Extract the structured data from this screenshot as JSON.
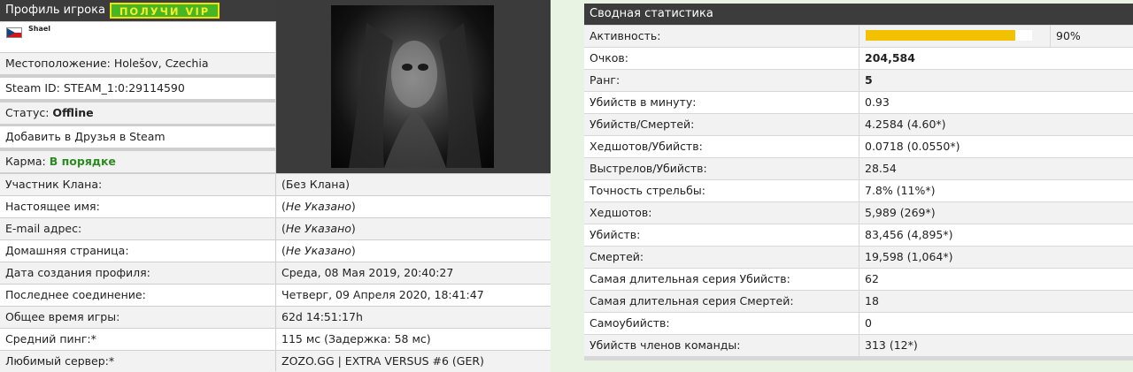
{
  "profile": {
    "header": "Профиль игрока",
    "vip_button": "ПОЛУЧИ VIP",
    "flag_icon": "czech-flag-icon",
    "nickname": "Shael",
    "location": "Местоположение: Holešov, Czechia",
    "steam_id": "Steam ID: STEAM_1:0:29114590",
    "status_label": "Статус:",
    "status_value": "Offline",
    "add_friend": "Добавить в Друзья в Steam",
    "karma_label": "Карма:",
    "karma_value": "В порядке",
    "karma_color": "#2d8b22",
    "rows": [
      {
        "label": "Участник Клана:",
        "value": "(Без Клана)",
        "italic": false
      },
      {
        "label": "Настоящее имя:",
        "value_pre": "(",
        "value_it": "Не Указано",
        "value_post": ")"
      },
      {
        "label": "E-mail адрес:",
        "value_pre": "(",
        "value_it": "Не Указано",
        "value_post": ")"
      },
      {
        "label": "Домашняя страница:",
        "value_pre": "(",
        "value_it": "Не Указано",
        "value_post": ")"
      },
      {
        "label": "Дата создания профиля:",
        "value": "Среда, 08 Мая 2019, 20:40:27"
      },
      {
        "label": "Последнее соединение:",
        "value": "Четверг, 09 Апреля 2020, 18:41:47"
      },
      {
        "label": "Общее время игры:",
        "value": "62d 14:51:17h"
      },
      {
        "label": "Средний пинг:*",
        "value": "115 мс (Задержка: 58 мс)"
      },
      {
        "label": "Любимый сервер:*",
        "value": "ZOZO.GG | EXTRA VERSUS #6 (GER)"
      }
    ]
  },
  "stats": {
    "header": "Сводная статистика",
    "activity_label": "Активность:",
    "activity_percent": 90,
    "activity_text": "90%",
    "bar_color": "#f2c200",
    "rows": [
      {
        "label": "Очков:",
        "value": "204,584",
        "bold": true
      },
      {
        "label": "Ранг:",
        "value": "5",
        "bold": true
      },
      {
        "label": "Убийств в минуту:",
        "value": "0.93"
      },
      {
        "label": "Убийств/Смертей:",
        "value": "4.2584 (4.60*)"
      },
      {
        "label": "Хедшотов/Убийств:",
        "value": "0.0718 (0.0550*)"
      },
      {
        "label": "Выстрелов/Убийств:",
        "value": "28.54"
      },
      {
        "label": "Точность стрельбы:",
        "value": "7.8% (11%*)"
      },
      {
        "label": "Хедшотов:",
        "value": "5,989 (269*)"
      },
      {
        "label": "Убийств:",
        "value": "83,456 (4,895*)"
      },
      {
        "label": "Смертей:",
        "value": "19,598 (1,064*)"
      },
      {
        "label": "Самая длительная серия Убийств:",
        "value": "62"
      },
      {
        "label": "Самая длительная серия Смертей:",
        "value": "18"
      },
      {
        "label": "Самоубийств:",
        "value": "0"
      },
      {
        "label": "Убийств членов команды:",
        "value": "313 (12*)"
      }
    ]
  }
}
